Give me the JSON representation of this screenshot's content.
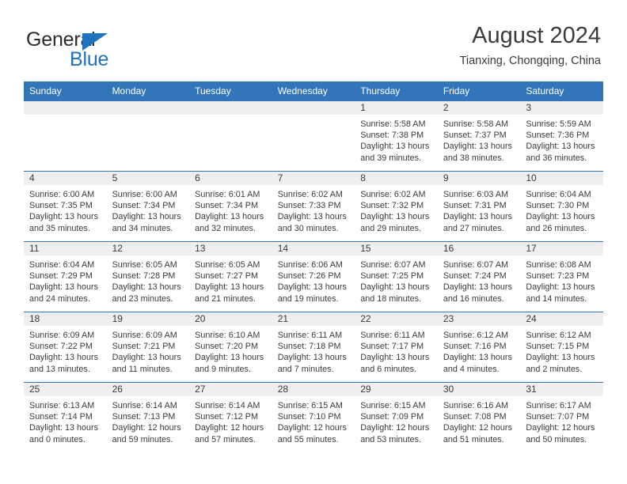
{
  "brand": {
    "name_part1": "General",
    "name_part2": "Blue",
    "logo_icon": "blue-triangle-icon",
    "color_blue": "#1f72bd",
    "color_dark": "#2b2b2b"
  },
  "header": {
    "title": "August 2024",
    "subtitle": "Tianxing, Chongqing, China"
  },
  "theme": {
    "header_row_bg": "#3275b8",
    "daynum_strip_bg": "#efefef",
    "grid_line": "#3275b8",
    "text": "#3a3a3a",
    "page_bg": "#ffffff"
  },
  "weekday_headers": [
    "Sunday",
    "Monday",
    "Tuesday",
    "Wednesday",
    "Thursday",
    "Friday",
    "Saturday"
  ],
  "weeks": [
    [
      {
        "day": "",
        "empty": true,
        "sunrise": "",
        "sunset": "",
        "daylight_line1": "",
        "daylight_line2": ""
      },
      {
        "day": "",
        "empty": true,
        "sunrise": "",
        "sunset": "",
        "daylight_line1": "",
        "daylight_line2": ""
      },
      {
        "day": "",
        "empty": true,
        "sunrise": "",
        "sunset": "",
        "daylight_line1": "",
        "daylight_line2": ""
      },
      {
        "day": "",
        "empty": true,
        "sunrise": "",
        "sunset": "",
        "daylight_line1": "",
        "daylight_line2": ""
      },
      {
        "day": "1",
        "empty": false,
        "sunrise": "Sunrise: 5:58 AM",
        "sunset": "Sunset: 7:38 PM",
        "daylight_line1": "Daylight: 13 hours",
        "daylight_line2": "and 39 minutes."
      },
      {
        "day": "2",
        "empty": false,
        "sunrise": "Sunrise: 5:58 AM",
        "sunset": "Sunset: 7:37 PM",
        "daylight_line1": "Daylight: 13 hours",
        "daylight_line2": "and 38 minutes."
      },
      {
        "day": "3",
        "empty": false,
        "sunrise": "Sunrise: 5:59 AM",
        "sunset": "Sunset: 7:36 PM",
        "daylight_line1": "Daylight: 13 hours",
        "daylight_line2": "and 36 minutes."
      }
    ],
    [
      {
        "day": "4",
        "empty": false,
        "sunrise": "Sunrise: 6:00 AM",
        "sunset": "Sunset: 7:35 PM",
        "daylight_line1": "Daylight: 13 hours",
        "daylight_line2": "and 35 minutes."
      },
      {
        "day": "5",
        "empty": false,
        "sunrise": "Sunrise: 6:00 AM",
        "sunset": "Sunset: 7:34 PM",
        "daylight_line1": "Daylight: 13 hours",
        "daylight_line2": "and 34 minutes."
      },
      {
        "day": "6",
        "empty": false,
        "sunrise": "Sunrise: 6:01 AM",
        "sunset": "Sunset: 7:34 PM",
        "daylight_line1": "Daylight: 13 hours",
        "daylight_line2": "and 32 minutes."
      },
      {
        "day": "7",
        "empty": false,
        "sunrise": "Sunrise: 6:02 AM",
        "sunset": "Sunset: 7:33 PM",
        "daylight_line1": "Daylight: 13 hours",
        "daylight_line2": "and 30 minutes."
      },
      {
        "day": "8",
        "empty": false,
        "sunrise": "Sunrise: 6:02 AM",
        "sunset": "Sunset: 7:32 PM",
        "daylight_line1": "Daylight: 13 hours",
        "daylight_line2": "and 29 minutes."
      },
      {
        "day": "9",
        "empty": false,
        "sunrise": "Sunrise: 6:03 AM",
        "sunset": "Sunset: 7:31 PM",
        "daylight_line1": "Daylight: 13 hours",
        "daylight_line2": "and 27 minutes."
      },
      {
        "day": "10",
        "empty": false,
        "sunrise": "Sunrise: 6:04 AM",
        "sunset": "Sunset: 7:30 PM",
        "daylight_line1": "Daylight: 13 hours",
        "daylight_line2": "and 26 minutes."
      }
    ],
    [
      {
        "day": "11",
        "empty": false,
        "sunrise": "Sunrise: 6:04 AM",
        "sunset": "Sunset: 7:29 PM",
        "daylight_line1": "Daylight: 13 hours",
        "daylight_line2": "and 24 minutes."
      },
      {
        "day": "12",
        "empty": false,
        "sunrise": "Sunrise: 6:05 AM",
        "sunset": "Sunset: 7:28 PM",
        "daylight_line1": "Daylight: 13 hours",
        "daylight_line2": "and 23 minutes."
      },
      {
        "day": "13",
        "empty": false,
        "sunrise": "Sunrise: 6:05 AM",
        "sunset": "Sunset: 7:27 PM",
        "daylight_line1": "Daylight: 13 hours",
        "daylight_line2": "and 21 minutes."
      },
      {
        "day": "14",
        "empty": false,
        "sunrise": "Sunrise: 6:06 AM",
        "sunset": "Sunset: 7:26 PM",
        "daylight_line1": "Daylight: 13 hours",
        "daylight_line2": "and 19 minutes."
      },
      {
        "day": "15",
        "empty": false,
        "sunrise": "Sunrise: 6:07 AM",
        "sunset": "Sunset: 7:25 PM",
        "daylight_line1": "Daylight: 13 hours",
        "daylight_line2": "and 18 minutes."
      },
      {
        "day": "16",
        "empty": false,
        "sunrise": "Sunrise: 6:07 AM",
        "sunset": "Sunset: 7:24 PM",
        "daylight_line1": "Daylight: 13 hours",
        "daylight_line2": "and 16 minutes."
      },
      {
        "day": "17",
        "empty": false,
        "sunrise": "Sunrise: 6:08 AM",
        "sunset": "Sunset: 7:23 PM",
        "daylight_line1": "Daylight: 13 hours",
        "daylight_line2": "and 14 minutes."
      }
    ],
    [
      {
        "day": "18",
        "empty": false,
        "sunrise": "Sunrise: 6:09 AM",
        "sunset": "Sunset: 7:22 PM",
        "daylight_line1": "Daylight: 13 hours",
        "daylight_line2": "and 13 minutes."
      },
      {
        "day": "19",
        "empty": false,
        "sunrise": "Sunrise: 6:09 AM",
        "sunset": "Sunset: 7:21 PM",
        "daylight_line1": "Daylight: 13 hours",
        "daylight_line2": "and 11 minutes."
      },
      {
        "day": "20",
        "empty": false,
        "sunrise": "Sunrise: 6:10 AM",
        "sunset": "Sunset: 7:20 PM",
        "daylight_line1": "Daylight: 13 hours",
        "daylight_line2": "and 9 minutes."
      },
      {
        "day": "21",
        "empty": false,
        "sunrise": "Sunrise: 6:11 AM",
        "sunset": "Sunset: 7:18 PM",
        "daylight_line1": "Daylight: 13 hours",
        "daylight_line2": "and 7 minutes."
      },
      {
        "day": "22",
        "empty": false,
        "sunrise": "Sunrise: 6:11 AM",
        "sunset": "Sunset: 7:17 PM",
        "daylight_line1": "Daylight: 13 hours",
        "daylight_line2": "and 6 minutes."
      },
      {
        "day": "23",
        "empty": false,
        "sunrise": "Sunrise: 6:12 AM",
        "sunset": "Sunset: 7:16 PM",
        "daylight_line1": "Daylight: 13 hours",
        "daylight_line2": "and 4 minutes."
      },
      {
        "day": "24",
        "empty": false,
        "sunrise": "Sunrise: 6:12 AM",
        "sunset": "Sunset: 7:15 PM",
        "daylight_line1": "Daylight: 13 hours",
        "daylight_line2": "and 2 minutes."
      }
    ],
    [
      {
        "day": "25",
        "empty": false,
        "sunrise": "Sunrise: 6:13 AM",
        "sunset": "Sunset: 7:14 PM",
        "daylight_line1": "Daylight: 13 hours",
        "daylight_line2": "and 0 minutes."
      },
      {
        "day": "26",
        "empty": false,
        "sunrise": "Sunrise: 6:14 AM",
        "sunset": "Sunset: 7:13 PM",
        "daylight_line1": "Daylight: 12 hours",
        "daylight_line2": "and 59 minutes."
      },
      {
        "day": "27",
        "empty": false,
        "sunrise": "Sunrise: 6:14 AM",
        "sunset": "Sunset: 7:12 PM",
        "daylight_line1": "Daylight: 12 hours",
        "daylight_line2": "and 57 minutes."
      },
      {
        "day": "28",
        "empty": false,
        "sunrise": "Sunrise: 6:15 AM",
        "sunset": "Sunset: 7:10 PM",
        "daylight_line1": "Daylight: 12 hours",
        "daylight_line2": "and 55 minutes."
      },
      {
        "day": "29",
        "empty": false,
        "sunrise": "Sunrise: 6:15 AM",
        "sunset": "Sunset: 7:09 PM",
        "daylight_line1": "Daylight: 12 hours",
        "daylight_line2": "and 53 minutes."
      },
      {
        "day": "30",
        "empty": false,
        "sunrise": "Sunrise: 6:16 AM",
        "sunset": "Sunset: 7:08 PM",
        "daylight_line1": "Daylight: 12 hours",
        "daylight_line2": "and 51 minutes."
      },
      {
        "day": "31",
        "empty": false,
        "sunrise": "Sunrise: 6:17 AM",
        "sunset": "Sunset: 7:07 PM",
        "daylight_line1": "Daylight: 12 hours",
        "daylight_line2": "and 50 minutes."
      }
    ]
  ]
}
